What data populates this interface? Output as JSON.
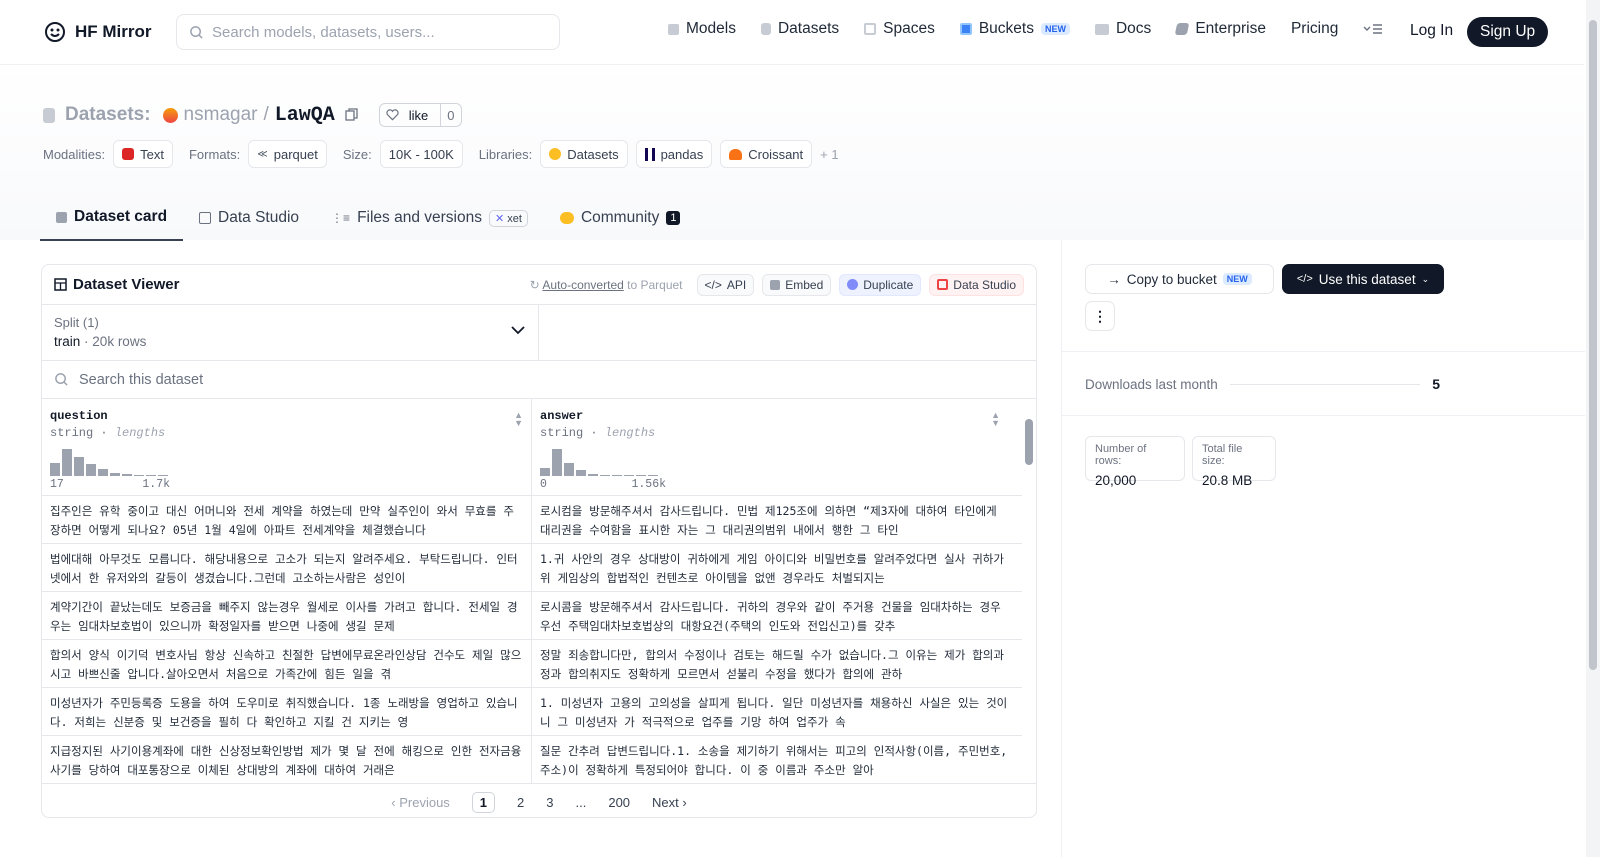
{
  "nav": {
    "logo_text": "HF Mirror",
    "search_placeholder": "Search models, datasets, users...",
    "links": [
      {
        "label": "Models",
        "icon": "cube-icon"
      },
      {
        "label": "Datasets",
        "icon": "database-icon"
      },
      {
        "label": "Spaces",
        "icon": "grid-icon"
      },
      {
        "label": "Buckets",
        "icon": "bucket-icon",
        "badge": "NEW"
      },
      {
        "label": "Docs",
        "icon": "book-icon"
      },
      {
        "label": "Enterprise",
        "icon": "enterprise-icon"
      },
      {
        "label": "Pricing"
      }
    ],
    "login": "Log In",
    "signup": "Sign Up"
  },
  "header": {
    "label": "Datasets:",
    "owner": "nsmagar",
    "slash": "/",
    "name": "LawQA",
    "like_label": "like",
    "like_count": "0",
    "modalities_label": "Modalities:",
    "modality": "Text",
    "formats_label": "Formats:",
    "format": "parquet",
    "size_label": "Size:",
    "size": "10K - 100K",
    "libraries_label": "Libraries:",
    "libraries": [
      "Datasets",
      "pandas",
      "Croissant"
    ],
    "libraries_more": "+ 1"
  },
  "tabs": {
    "card": "Dataset card",
    "studio": "Data Studio",
    "files": "Files and versions",
    "xet": "xet",
    "community": "Community",
    "community_count": "1"
  },
  "viewer": {
    "title": "Dataset Viewer",
    "auto_converted": "Auto-converted",
    "to_parquet": " to Parquet",
    "api": "API",
    "embed": "Embed",
    "duplicate": "Duplicate",
    "data_studio": "Data Studio",
    "split_label": "Split (1)",
    "split_value": "train",
    "split_rows": "20k rows",
    "search_placeholder": "Search this dataset",
    "columns": [
      {
        "name": "question",
        "type": "string",
        "stat": "lengths",
        "min": "17",
        "max": "1.7k"
      },
      {
        "name": "answer",
        "type": "string",
        "stat": "lengths",
        "min": "0",
        "max": "1.56k"
      }
    ],
    "rows": [
      [
        "집주인은 유학 중이고 대신 어머니와 전세 계약을 하였는데 만약 실주인이 와서 무효를 주장하면 어떻게 되나요? 05년 1월 4일에 아파트 전세계약을 체결했습니다",
        "로시컴을 방문해주셔서 감사드립니다. 민법 제125조에 의하면 “제3자에 대하여 타인에게 대리권을 수여함을 표시한 자는 그 대리권의범위 내에서 행한 그 타인"
      ],
      [
        "법에대해 아무것도 모릅니다. 해당내용으로 고소가 되는지 알려주세요. 부탁드립니다. 인터넷에서 한 유저와의 갈등이 생겼습니다.그런데 고소하는사람은 성인이",
        "1.귀 사안의 경우 상대방이 귀하에게 게임 아이디와 비밀번호를 알려주었다면 실사 귀하가 위 게임상의 합법적인 컨텐츠로 아이템을 없앤 경우라도 처벌되지는"
      ],
      [
        "계약기간이 끝났는데도 보증금을 빼주지 않는경우 월세로 이사를 가려고 합니다. 전세일 경우는 임대차보호법이 있으니까 확정일자를 받으면 나중에 생길 문제",
        "로시콤을 방문해주셔서 감사드립니다. 귀하의 경우와 같이 주거용 건물을 임대차하는 경우 우선 주택임대차보호법상의 대항요건(주택의 인도와 전입신고)를 갖추"
      ],
      [
        "합의서 양식 이기덕 변호사님 항상 신속하고 친절한 답변에무료온라인상담 건수도 제일 많으시고 바쁘신줄 압니다.살아오면서 처음으로 가족간에 힘든 일을 겪",
        "정말 죄송합니다만, 합의서 수정이나 검토는 해드릴 수가 없습니다.그 이유는 제가 합의과정과 합의취지도 정확하게 모르면서 섣불리 수정을 했다가 합의에 관하"
      ],
      [
        "미성년자가 주민등록증 도용을 하여 도우미로 취직했습니다. 1종 노래방을 영업하고 있습니다. 저희는 신분증 및 보건증을 필히 다 확인하고 지킬 건 지키는 영",
        "1. 미성년자 고용의 고의성을 살피게 됩니다. 일단 미성년자를 채용하신 사실은 있는 것이니 그 미성년자   가 적극적으로 업주를 기망 하여 업주가 속"
      ],
      [
        "지급정지된 사기이용계좌에 대한 신상정보확인방법 제가 몇 달 전에 해킹으로 인한 전자금융사기를 당하여 대포통장으로 이체된 상대방의 계좌에 대하여 거래은",
        "질문 간추려 답변드립니다.1. 소송을 제기하기 위해서는 피고의 인적사항(이름, 주민번호, 주소)이 정확하게 특정되어야 합니다. 이 중 이름과 주소만 알아"
      ]
    ],
    "pager": {
      "prev": "Previous",
      "pages": [
        "1",
        "2",
        "3",
        "...",
        "200"
      ],
      "next": "Next"
    }
  },
  "side": {
    "copy_bucket": "Copy to bucket",
    "copy_badge": "NEW",
    "use_dataset": "Use this dataset",
    "more": "⋮",
    "downloads_label": "Downloads last month",
    "downloads_value": "5",
    "rows_label": "Number of rows:",
    "rows_value": "20,000",
    "size_label": "Total file size:",
    "size_value": "20.8 MB"
  },
  "histograms": {
    "question": [
      0.45,
      0.95,
      0.68,
      0.42,
      0.25,
      0.12,
      0.06,
      0.04,
      0.03,
      0.03
    ],
    "answer": [
      0.28,
      0.95,
      0.48,
      0.2,
      0.06,
      0.03,
      0.02,
      0.02,
      0.02,
      0.02
    ]
  }
}
